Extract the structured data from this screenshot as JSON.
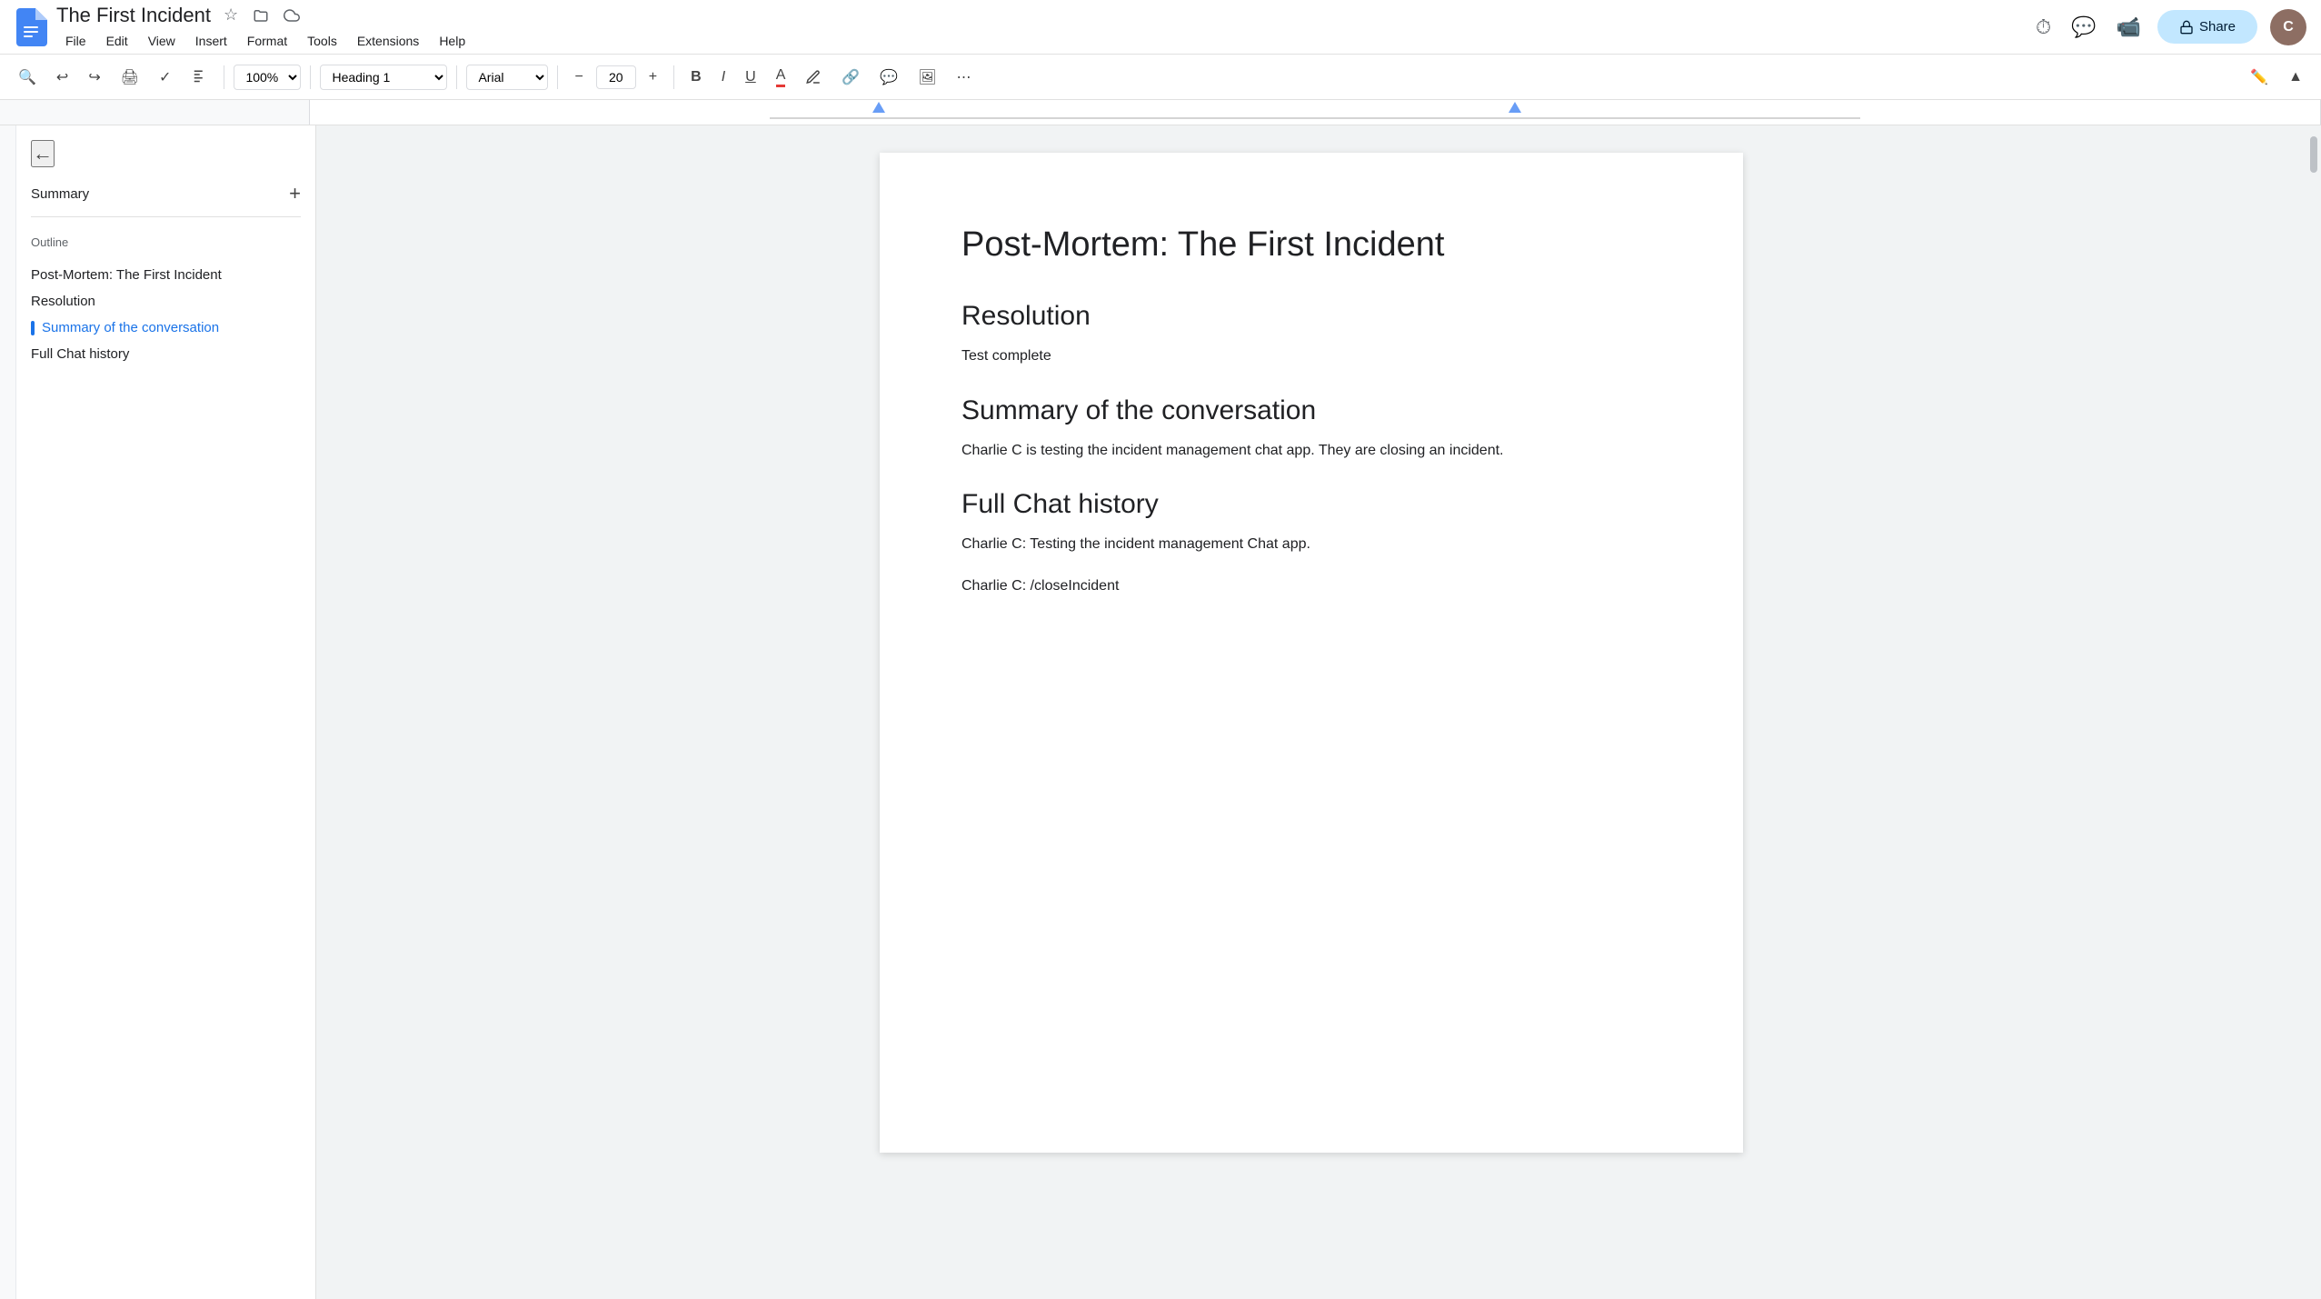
{
  "titlebar": {
    "doc_title": "The First Incident",
    "file_menu": "File",
    "edit_menu": "Edit",
    "view_menu": "View",
    "insert_menu": "Insert",
    "format_menu": "Format",
    "tools_menu": "Tools",
    "extensions_menu": "Extensions",
    "help_menu": "Help",
    "share_label": "Share"
  },
  "toolbar": {
    "zoom_value": "100%",
    "style_value": "Heading 1",
    "font_value": "Arial",
    "font_size": "20"
  },
  "sidebar": {
    "summary_label": "Summary",
    "outline_label": "Outline",
    "items": [
      {
        "label": "Post-Mortem: The First Incident",
        "active": false
      },
      {
        "label": "Resolution",
        "active": false
      },
      {
        "label": "Summary of the conversation",
        "active": true
      },
      {
        "label": "Full Chat history",
        "active": false
      }
    ]
  },
  "document": {
    "main_title": "Post-Mortem: The First Incident",
    "sections": [
      {
        "heading": "Resolution",
        "body": "Test complete"
      },
      {
        "heading": "Summary of the conversation",
        "body": "Charlie C is testing the incident management chat app. They are closing an incident."
      },
      {
        "heading": "Full Chat history",
        "lines": [
          "Charlie C: Testing the incident management Chat app.",
          "Charlie C: /closeIncident"
        ]
      }
    ]
  }
}
